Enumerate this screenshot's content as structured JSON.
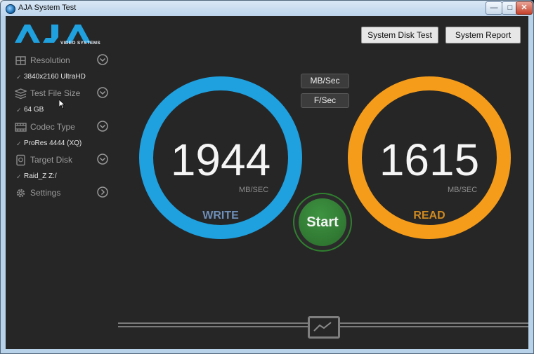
{
  "window": {
    "title": "AJA System Test",
    "controls": {
      "minimize": "—",
      "maximize": "□",
      "close": "✕"
    }
  },
  "logo": {
    "brand": "AJA",
    "subtitle": "VIDEO SYSTEMS",
    "color": "#1fa0df"
  },
  "top_buttons": {
    "disk_test": "System Disk Test",
    "report": "System Report"
  },
  "sidebar": {
    "items": [
      {
        "label": "Resolution",
        "value": "3840x2160 UltraHD",
        "icon": "resolution-icon",
        "chevron": "chevron-down"
      },
      {
        "label": "Test File Size",
        "value": "64 GB",
        "icon": "stack-icon",
        "chevron": "chevron-down"
      },
      {
        "label": "Codec Type",
        "value": "ProRes 4444 (XQ)",
        "icon": "film-icon",
        "chevron": "chevron-down"
      },
      {
        "label": "Target Disk",
        "value": "Raid_Z Z:/",
        "icon": "disk-icon",
        "chevron": "chevron-down"
      },
      {
        "label": "Settings",
        "value": "",
        "icon": "gear-icon",
        "chevron": "chevron-right"
      }
    ]
  },
  "units": {
    "mb": "MB/Sec",
    "frames": "F/Sec"
  },
  "write": {
    "value": "1944",
    "unit": "MB/SEC",
    "label": "WRITE",
    "color": "#1fa0df"
  },
  "read": {
    "value": "1615",
    "unit": "MB/SEC",
    "label": "READ",
    "color": "#f59c1b"
  },
  "start": {
    "label": "Start",
    "color": "#2f7f2f"
  },
  "graph_toggle_icon": "line-chart-icon"
}
